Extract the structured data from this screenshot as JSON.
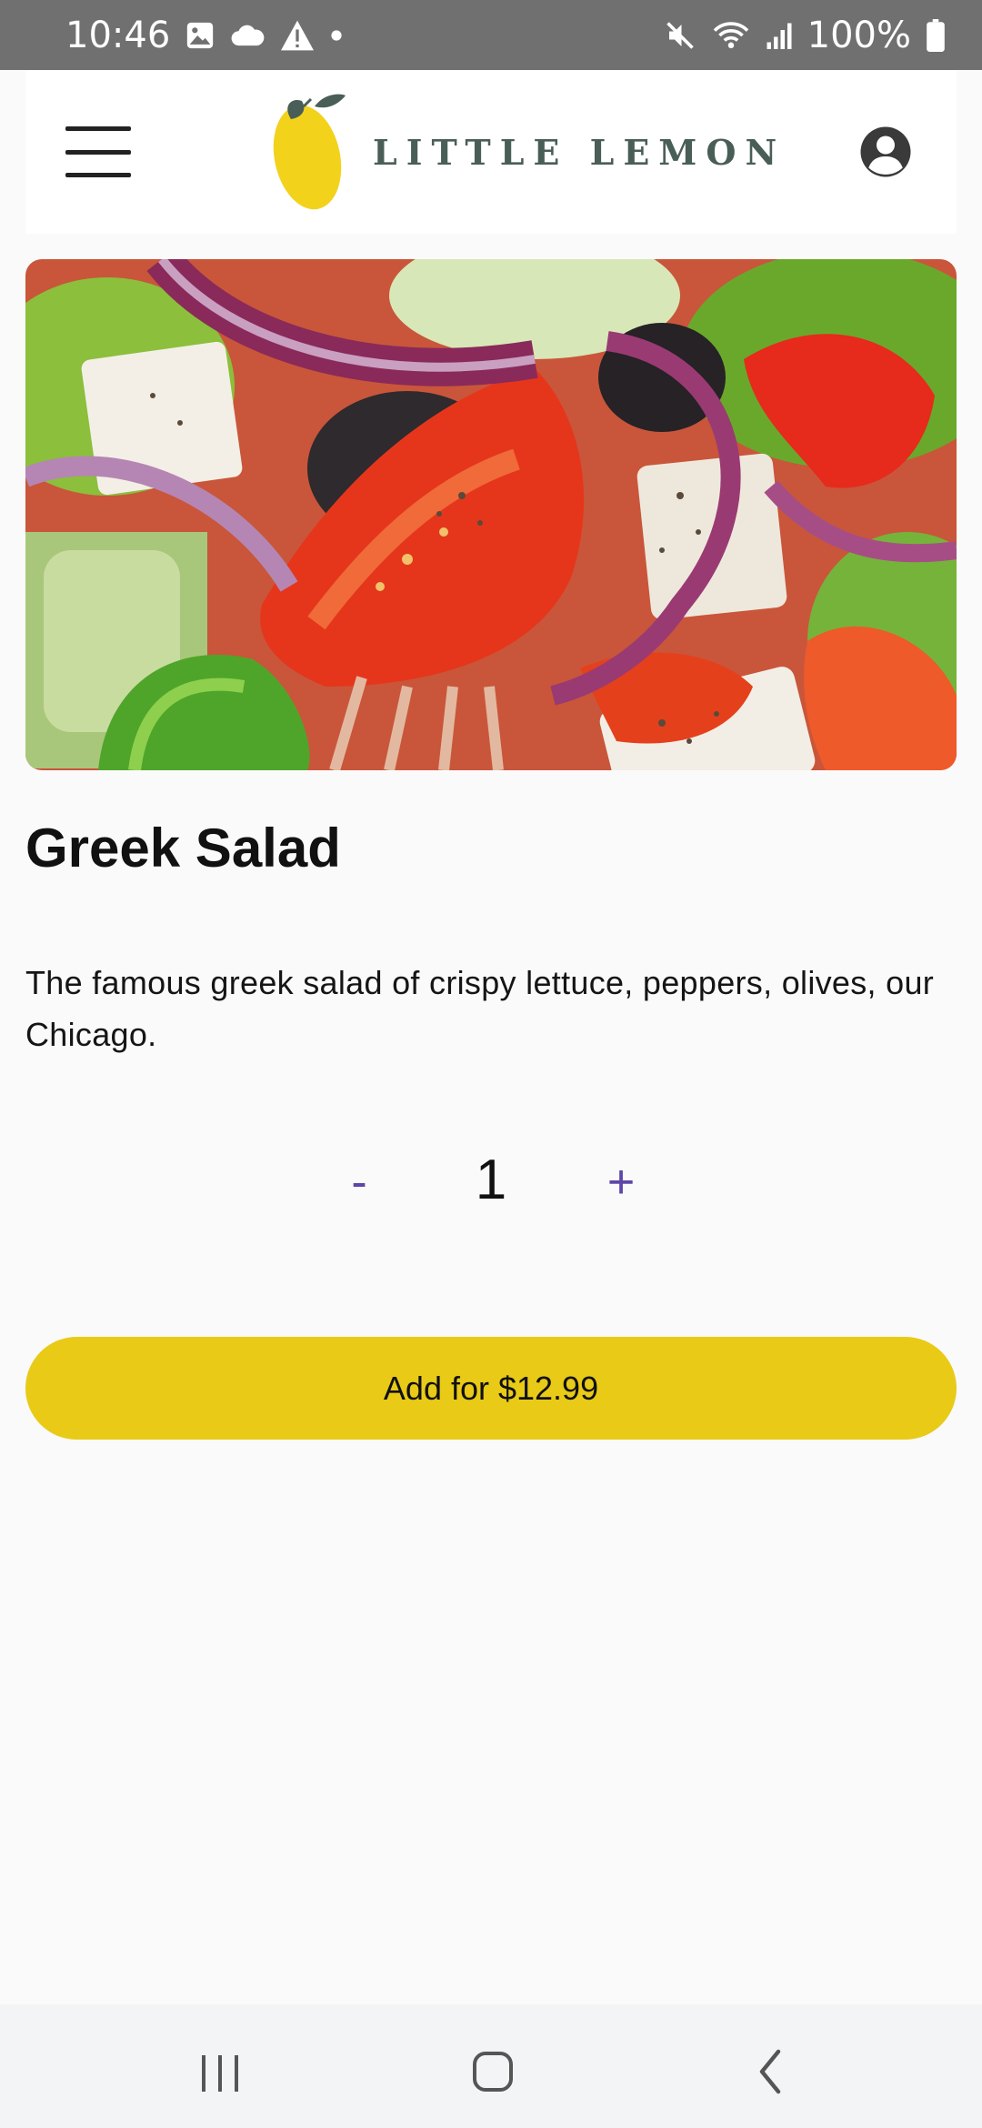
{
  "status_bar": {
    "time": "10:46",
    "battery_percent": "100%",
    "left_icons": [
      "gallery-icon",
      "cloud-icon",
      "warning-icon",
      "dot-icon"
    ],
    "right_icons": [
      "mute-icon",
      "wifi-icon",
      "signal-icon",
      "battery-icon"
    ]
  },
  "header": {
    "brand": "LITTLE LEMON",
    "menu_icon": "hamburger-menu-icon",
    "profile_icon": "account-circle-icon"
  },
  "dish": {
    "title": "Greek Salad",
    "description": "The famous greek salad of crispy lettuce, peppers, olives, our Chicago."
  },
  "quantity": {
    "decrement_label": "-",
    "value": "1",
    "increment_label": "+"
  },
  "add_button_label": "Add for $12.99",
  "colors": {
    "accent_yellow": "#E9CA17",
    "brand_green": "#495E57",
    "stepper_purple": "#5E46A8"
  },
  "nav_bar": {
    "icons": [
      "recents-icon",
      "home-icon",
      "back-icon"
    ]
  }
}
